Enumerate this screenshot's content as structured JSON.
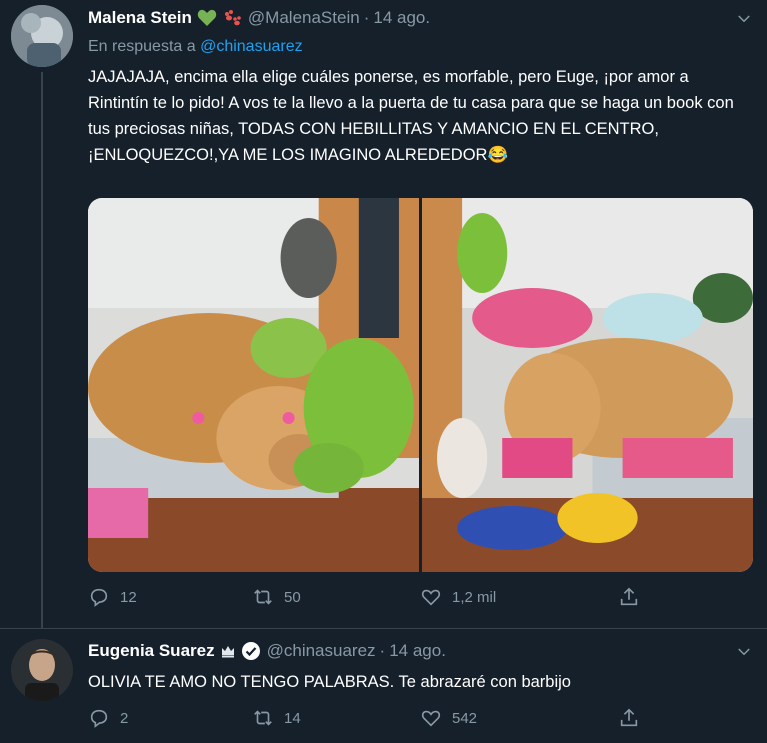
{
  "tweets": [
    {
      "name": "Malena Stein",
      "handle": "@MalenaStein",
      "separator": "·",
      "date": "14 ago.",
      "emoji_icons": [
        "green-heart-icon",
        "paw-prints-icon"
      ],
      "reply_prefix": "En respuesta a",
      "reply_to": "@chinasuarez",
      "text": "JAJAJAJA, encima ella elige cuáles ponerse, es morfable, pero Euge, ¡por amor a Rintintín te lo pido! A vos te la llevo a la puerta de tu casa para que se haga un book con tus preciosas niñas, TODAS CON HEBILLITAS Y AMANCIO EN EL CENTRO, ¡ENLOQUEZCO!,YA ME LOS IMAGINO ALREDEDOR😂",
      "media": [
        {
          "subject": "golden retriever lying with plush toys, pink bows"
        },
        {
          "subject": "golden retriever lying on pink blanket among plush toys"
        }
      ],
      "counts": {
        "replies": "12",
        "retweets": "50",
        "likes": "1,2 mil"
      }
    },
    {
      "name": "Eugenia Suarez",
      "handle": "@chinasuarez",
      "separator": "·",
      "date": "14 ago.",
      "emoji_icons": [
        "crown-icon",
        "verified-badge-icon"
      ],
      "text": "OLIVIA TE AMO NO TENGO PALABRAS. Te abrazaré con barbijo",
      "counts": {
        "replies": "2",
        "retweets": "14",
        "likes": "542"
      }
    }
  ],
  "colors": {
    "background": "#15202b",
    "text_primary": "#ffffff",
    "text_secondary": "#8899a6",
    "link": "#1da1f2",
    "divider": "#38444d",
    "verified": "#ffffff"
  }
}
